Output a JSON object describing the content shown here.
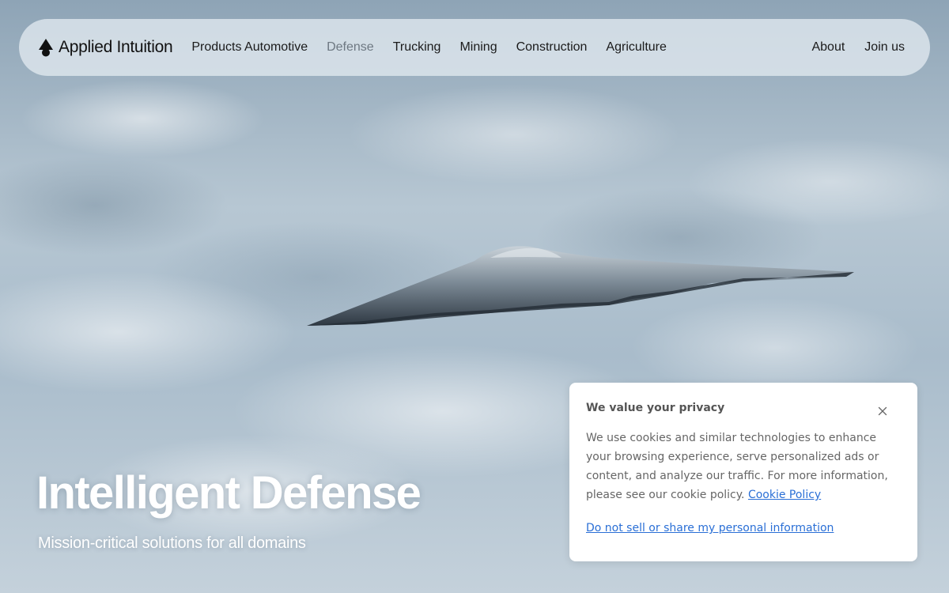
{
  "brand": {
    "name": "Applied Intuition",
    "icon": "applied-intuition-logo-icon"
  },
  "nav": {
    "items": [
      {
        "label": "Products Automotive",
        "active": false
      },
      {
        "label": "Defense",
        "active": true
      },
      {
        "label": "Trucking",
        "active": false
      },
      {
        "label": "Mining",
        "active": false
      },
      {
        "label": "Construction",
        "active": false
      },
      {
        "label": "Agriculture",
        "active": false
      }
    ],
    "about": "About",
    "join": "Join us"
  },
  "hero": {
    "title": "Intelligent Defense",
    "subtitle": "Mission-critical solutions for all domains"
  },
  "cookie": {
    "title": "We value your privacy",
    "body": "We use cookies and similar technologies to enhance your browsing experience, serve personalized ads or content, and analyze our traffic. For more information, please see our cookie policy.",
    "policy_link": "Cookie Policy",
    "opt_out_link": "Do not sell or share my personal information",
    "close_icon": "close-icon"
  },
  "colors": {
    "nav_active": "#6e7882",
    "link": "#2a6fd6",
    "hero_text": "#ffffff"
  }
}
